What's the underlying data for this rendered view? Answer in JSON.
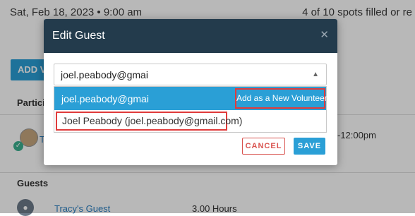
{
  "background": {
    "date": "Sat, Feb 18, 2023 • 9:00 am",
    "spots": "4 of 10 spots filled or re",
    "add_button_label": "ADD V",
    "participants_label": "Partici",
    "participant_link": "T",
    "time_text": "-12:00pm",
    "guests_label": "Guests",
    "guest_name": "Tracy's Guest",
    "guest_hours": "3.00 Hours"
  },
  "modal": {
    "title": "Edit Guest",
    "close_icon": "close-icon",
    "search": {
      "value": "joel.peabody@gmai"
    },
    "dropdown": {
      "highlighted_option": "joel.peabody@gmai",
      "add_volunteer_label": "Add as a New Volunteer",
      "result_option": "Joel Peabody (joel.peabody@gmail.com)"
    },
    "cancel_label": "CANCEL",
    "save_label": "SAVE"
  },
  "colors": {
    "header_dark": "#233b4c",
    "accent_blue": "#2a9fd6",
    "highlight_red": "#e03b3b",
    "cancel_red": "#d9534f"
  }
}
